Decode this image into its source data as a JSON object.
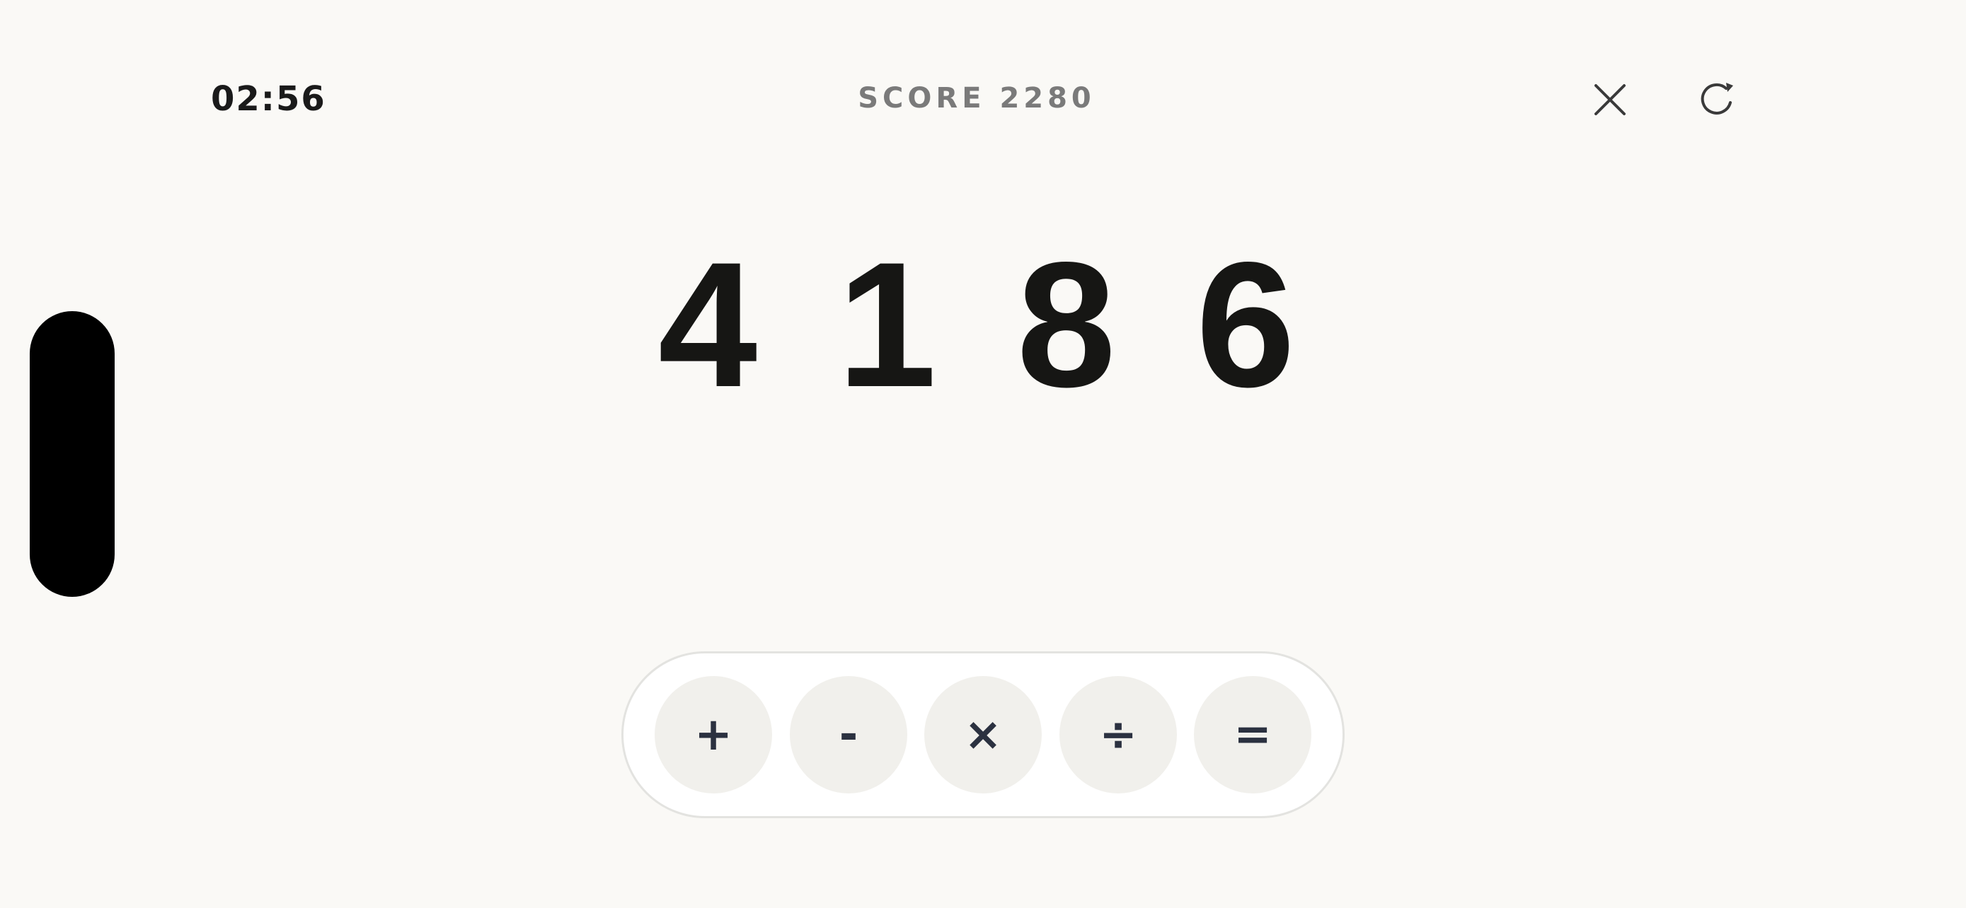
{
  "header": {
    "timer": "02:56",
    "score": "SCORE 2280",
    "close_icon": "close-icon",
    "restart_icon": "restart-icon"
  },
  "puzzle": {
    "digits": [
      "4",
      "1",
      "8",
      "6"
    ]
  },
  "operators": [
    {
      "label": "+",
      "name": "plus"
    },
    {
      "label": "-",
      "name": "minus"
    },
    {
      "label": "×",
      "name": "multiply"
    },
    {
      "label": "÷",
      "name": "divide"
    },
    {
      "label": "=",
      "name": "equals"
    }
  ],
  "colors": {
    "background": "#faf9f6",
    "digit": "#161614",
    "operator_text": "#2b3140",
    "operator_bg": "#f1f0ec",
    "score_text": "#7a7a7a"
  }
}
